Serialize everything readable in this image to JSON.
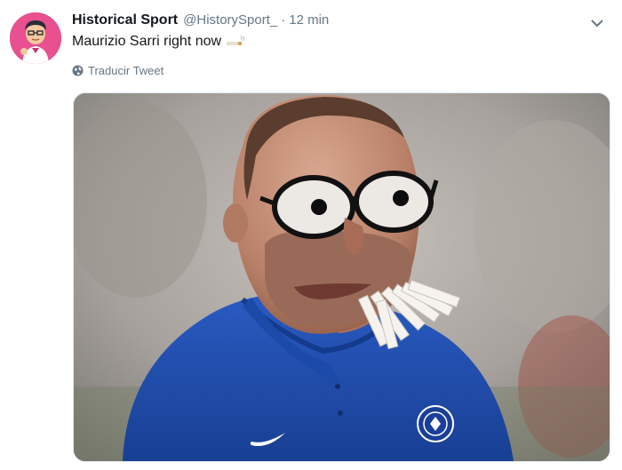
{
  "tweet": {
    "display_name": "Historical Sport",
    "handle": "@HistorySport_",
    "separator": "·",
    "time": "12 min",
    "text": "Maurizio Sarri right now",
    "translate_label": "Traducir Tweet"
  },
  "icons": {
    "avatar": "avatar-cartoon-boy",
    "caret": "chevron-down-icon",
    "globe": "globe-icon",
    "emoji": "cigarette-emoji"
  },
  "colors": {
    "text_primary": "#14171a",
    "text_secondary": "#657786",
    "shirt_blue": "#1f4fb5"
  }
}
